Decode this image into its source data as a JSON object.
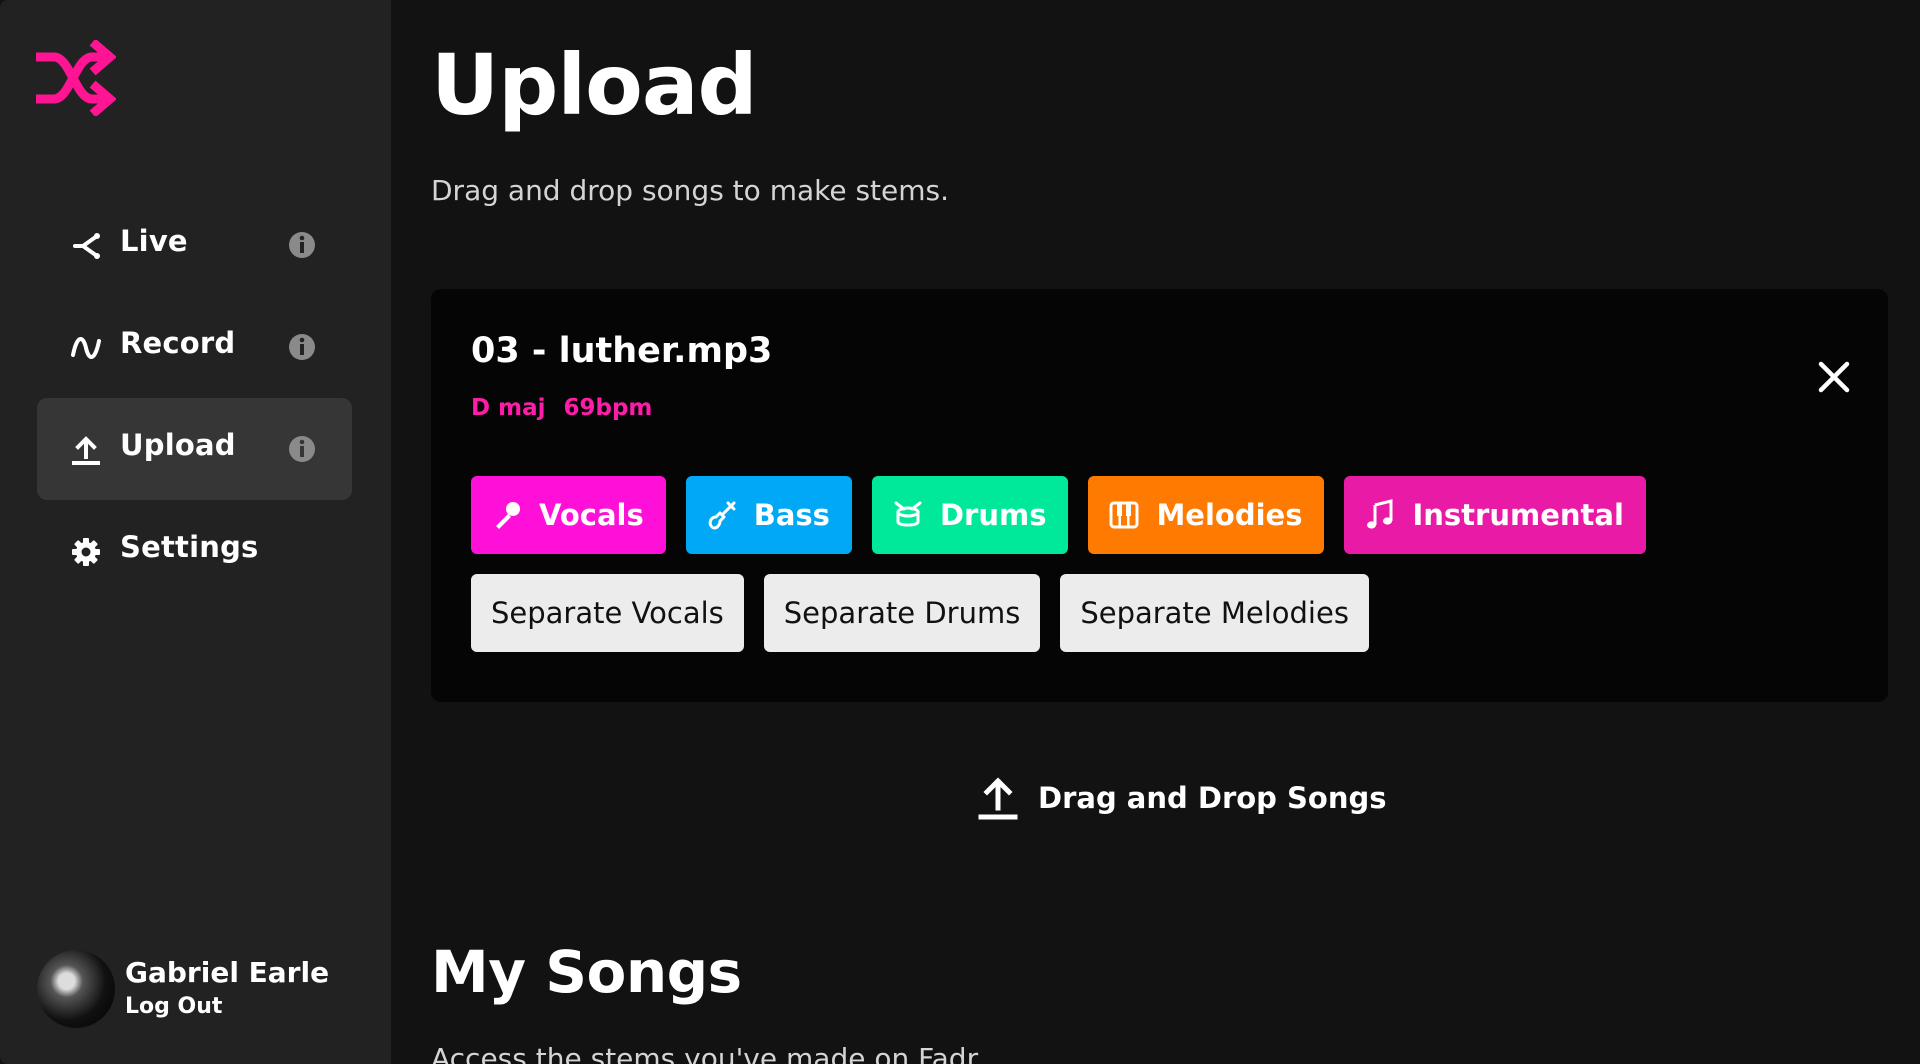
{
  "colors": {
    "brand": "#ff1493",
    "sidebar_bg": "#222222",
    "main_bg": "#121212",
    "vocals": "#ff10d8",
    "bass": "#00a8f5",
    "drums": "#00e99a",
    "melodies": "#ff7a00",
    "instrumental": "#e81aa6"
  },
  "sidebar": {
    "logo_icon": "shuffle-logo-icon",
    "items": [
      {
        "label": "Live",
        "icon": "live-share-icon",
        "active": false
      },
      {
        "label": "Record",
        "icon": "waveform-icon",
        "active": false
      },
      {
        "label": "Upload",
        "icon": "upload-icon",
        "active": true
      },
      {
        "label": "Settings",
        "icon": "gear-icon",
        "active": false
      }
    ],
    "user": {
      "name": "Gabriel Earle",
      "logout_label": "Log Out"
    }
  },
  "main": {
    "title": "Upload",
    "subtitle": "Drag and drop songs to make stems.",
    "song": {
      "title": "03 - luther.mp3",
      "key": "D maj",
      "bpm": "69bpm",
      "stems": [
        {
          "label": "Vocals",
          "icon": "microphone-icon"
        },
        {
          "label": "Bass",
          "icon": "guitar-icon"
        },
        {
          "label": "Drums",
          "icon": "drum-icon"
        },
        {
          "label": "Melodies",
          "icon": "piano-icon"
        },
        {
          "label": "Instrumental",
          "icon": "music-note-icon"
        }
      ],
      "separate": [
        {
          "label": "Separate Vocals"
        },
        {
          "label": "Separate Drums"
        },
        {
          "label": "Separate Melodies"
        }
      ]
    },
    "drop_label": "Drag and Drop Songs",
    "my_songs_title": "My Songs",
    "my_songs_subtitle": "Access the stems you've made on Fadr."
  }
}
